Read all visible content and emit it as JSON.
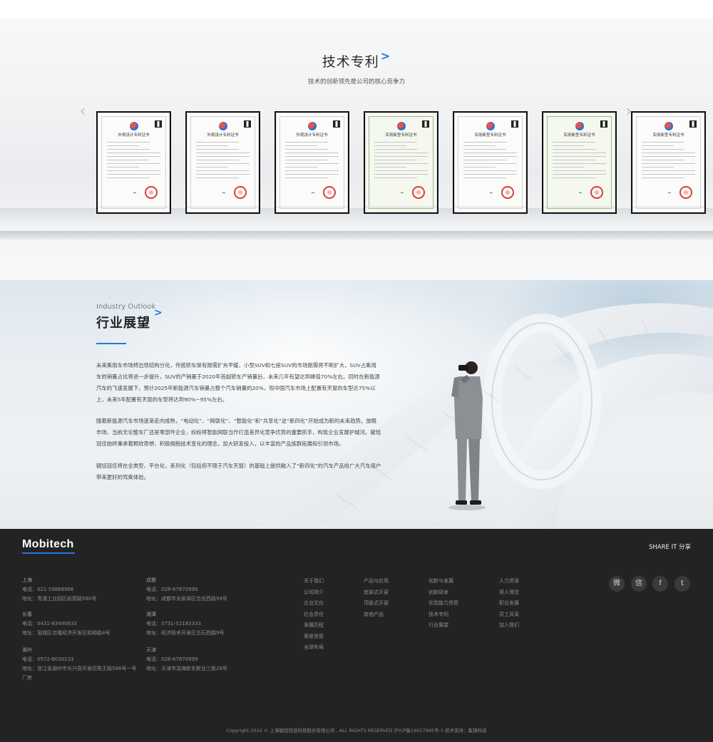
{
  "patents": {
    "title": "技术专利",
    "subtitle": "技术的创新领先是公司的核心竞争力",
    "prev_icon": "‹",
    "next_icon": "›",
    "certificates": [
      {
        "title": "外观设计专利证书",
        "style": "plain"
      },
      {
        "title": "外观设计专利证书",
        "style": "plain"
      },
      {
        "title": "外观设计专利证书",
        "style": "plain"
      },
      {
        "title": "实用新型专利证书",
        "style": "green"
      },
      {
        "title": "实用新型专利证书",
        "style": "plain"
      },
      {
        "title": "实用新型专利证书",
        "style": "green"
      },
      {
        "title": "实用新型专利证书",
        "style": "plain"
      }
    ]
  },
  "outlook": {
    "title_en": "Industry Outlook",
    "title_cn": "行业展望",
    "paragraphs": [
      "未来乘用车市场将出现结构分化，传统轿车保有刚需扩充平缓，小型SUV和七座SUV的市场刚需将不断扩大，SUV占乘用车的销量占比将进一步提升，SUV的产销量于2020年首超轿车产销量后，未来几年有望达到峰值70%左右。同时在新能源汽车的飞速发展下，预计2025年新能源汽车销量占整个汽车销量的20%，现中国汽车市场上配置有天窗的车型达75%以上，未来5年配置有天窗的车型将达到90%~95%左右。",
      "随着新能源汽车市场逐渐走向成熟，“电动化”、“网联化”、“智能化”和“共享化”这“新四化”开始成为新的未来趋势。放眼市场，当前无论整车厂还是零部件企业，纷纷将智能网联当作打造差异化竞争优势的重要抓手，构筑企业发展护城河。毓恬冠佳始终秉承着颗欣思想，积极拥抱技术变化的理念，加大研发投入，以丰富的产品族群拓展和引领市场。",
      "毓恬冠佳将在全类型，平台化，系列化（包括但不限于汽车天窗）的基础上提供融入了“新四化”的汽车产品给广大汽车用户带来更好的驾乘体验。"
    ]
  },
  "footer": {
    "logo": "Mobitech",
    "share": "SHARE IT 分享",
    "offices_left": [
      {
        "city": "上海",
        "phone": "电话：021-59868966",
        "address": "地址：青浦工业园区崧德路580号"
      },
      {
        "city": "长春",
        "phone": "电话：0431-83490633",
        "address": "地址：宽城区合隆经济开发区和顺路4号"
      },
      {
        "city": "湖州",
        "phone": "电话：0572-6030233",
        "address": "地址：浙江省湖州市长兴县开发区陈王路588号一号厂房"
      }
    ],
    "offices_right": [
      {
        "city": "成都",
        "phone": "电话：028-67870999",
        "address": "地址：成都市龙泉驿区合志西路99号"
      },
      {
        "city": "湘潭",
        "phone": "电话：0731-52183333",
        "address": "地址：经济技术开发区白石西路9号"
      },
      {
        "city": "天津",
        "phone": "电话：028-67870999",
        "address": "地址：天津市滨海新东新业三街29号"
      }
    ],
    "nav_columns": [
      [
        "关于我们",
        "公司简介",
        "企业文化",
        "社会责任",
        "发展历程",
        "荣誉资质",
        "全球布局"
      ],
      [
        "产品与应用",
        "底装式天窗",
        "顶装式天窗",
        "其他产品"
      ],
      [
        "创新与发展",
        "创新研发",
        "实验能力资质",
        "技术专利",
        "行业展望"
      ],
      [
        "人力资源",
        "用人理念",
        "职业发展",
        "员工风采",
        "加入我们"
      ]
    ],
    "social_icons": [
      "weibo-icon",
      "wechat-icon",
      "facebook-icon",
      "twitter-icon"
    ],
    "social_glyphs": [
      "微",
      "信",
      "f",
      "t"
    ],
    "copyright": "Copyright 2022 © 上海毓恬冠佳科技股份有限公司 , ALL RIGHTS RESERVED  沪ICP备16027965号-1  技术支持：集锦科技"
  },
  "colors": {
    "accent": "#1e7be0",
    "footer_bg": "#232323"
  }
}
